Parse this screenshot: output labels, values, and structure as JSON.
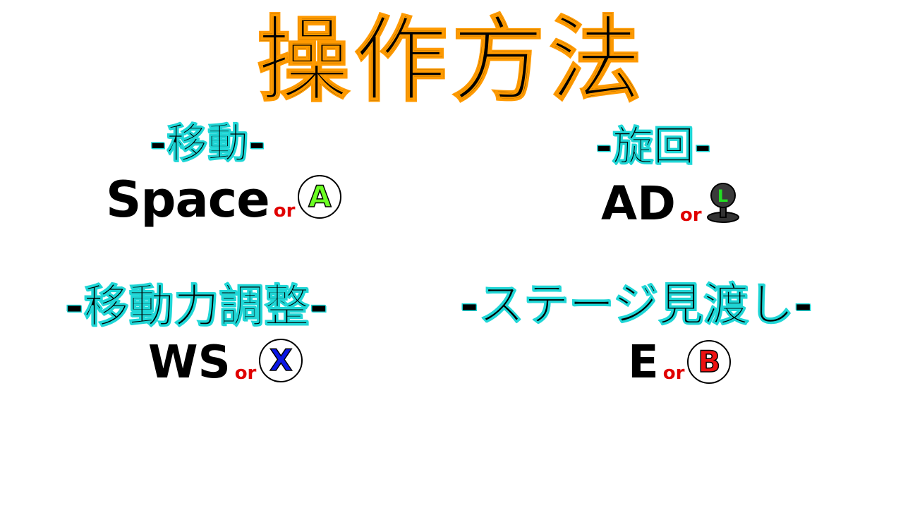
{
  "title": "操作方法",
  "sections": {
    "move": {
      "heading": "-移動-",
      "keys": "Space",
      "or": "or",
      "button": {
        "label": "A",
        "color": "#6bff22"
      }
    },
    "turn": {
      "heading": "-旋回-",
      "keys": "AD",
      "or": "or",
      "stick": {
        "label": "L",
        "icon": "left-stick-icon",
        "color": "#22dd22"
      }
    },
    "power": {
      "heading": "-移動力調整-",
      "keys": "WS",
      "or": "or",
      "button": {
        "label": "X",
        "color": "#0a16e6"
      }
    },
    "overview": {
      "heading": "-ステージ見渡し-",
      "keys": "E",
      "or": "or",
      "button": {
        "label": "B",
        "color": "#ee1111"
      }
    }
  },
  "colors": {
    "title_outline": "#ff9a00",
    "heading_outline": "#1fd6d6",
    "or_text": "#e00000"
  }
}
